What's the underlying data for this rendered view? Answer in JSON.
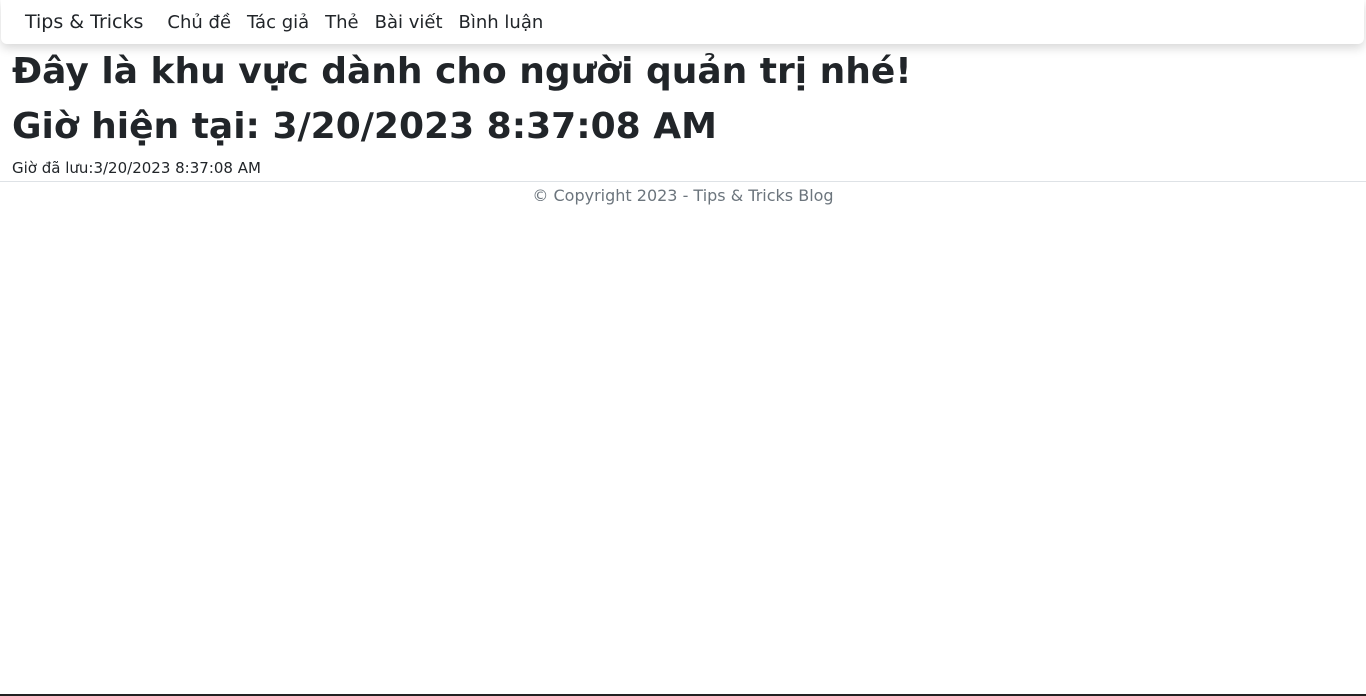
{
  "navbar": {
    "brand": "Tips & Tricks",
    "links": [
      "Chủ đề",
      "Tác giả",
      "Thẻ",
      "Bài viết",
      "Bình luận"
    ]
  },
  "main": {
    "heading": "Đây là khu vực dành cho người quản trị nhé!",
    "current_time": "Giờ hiện tại: 3/20/2023 8:37:08 AM",
    "saved_time": "Giờ đã lưu:3/20/2023 8:37:08 AM"
  },
  "footer": {
    "text": "© Copyright 2023 - Tips & Tricks Blog"
  }
}
